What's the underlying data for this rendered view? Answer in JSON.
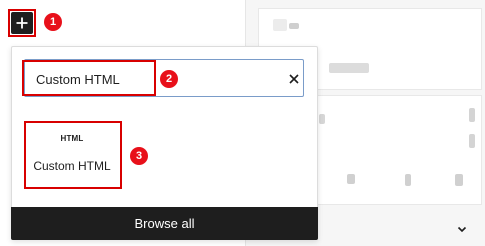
{
  "toolbar": {
    "add_block_icon": "plus-icon"
  },
  "inserter": {
    "search_value": "Custom HTML",
    "clear_icon": "close-icon",
    "results": [
      {
        "icon_text": "HTML",
        "label": "Custom HTML"
      }
    ],
    "browse_all_label": "Browse all"
  },
  "annotations": {
    "step1": "1",
    "step2": "2",
    "step3": "3",
    "highlight_color": "#d80000",
    "badge_color": "#e8101a"
  },
  "sidebar": {
    "expand_icon": "chevron-down-icon"
  }
}
